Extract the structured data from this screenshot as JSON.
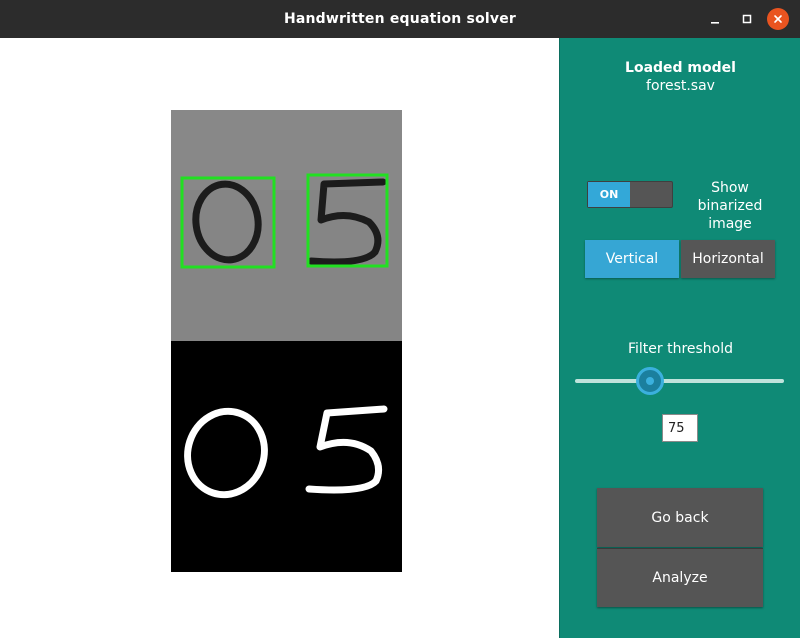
{
  "window": {
    "title": "Handwritten equation solver",
    "controls": [
      "minimize-icon",
      "maximize-icon",
      "close-icon"
    ],
    "close_color": "#e95420"
  },
  "preview": {
    "digit_boxes": [
      "0",
      "5"
    ],
    "box_color": "#22e022"
  },
  "panel": {
    "background": "#0f8a76",
    "model_title": "Loaded model",
    "model_file": "forest.sav",
    "toggle": {
      "state_label": "ON",
      "label": "Show binarized image",
      "checked": true
    },
    "orientation": {
      "vertical_label": "Vertical",
      "horizontal_label": "Horizontal",
      "selected": "Vertical"
    },
    "filter": {
      "label": "Filter threshold",
      "value": "75",
      "slider_fraction": 0.35
    },
    "buttons": {
      "back_label": "Go back",
      "analyze_label": "Analyze"
    }
  }
}
